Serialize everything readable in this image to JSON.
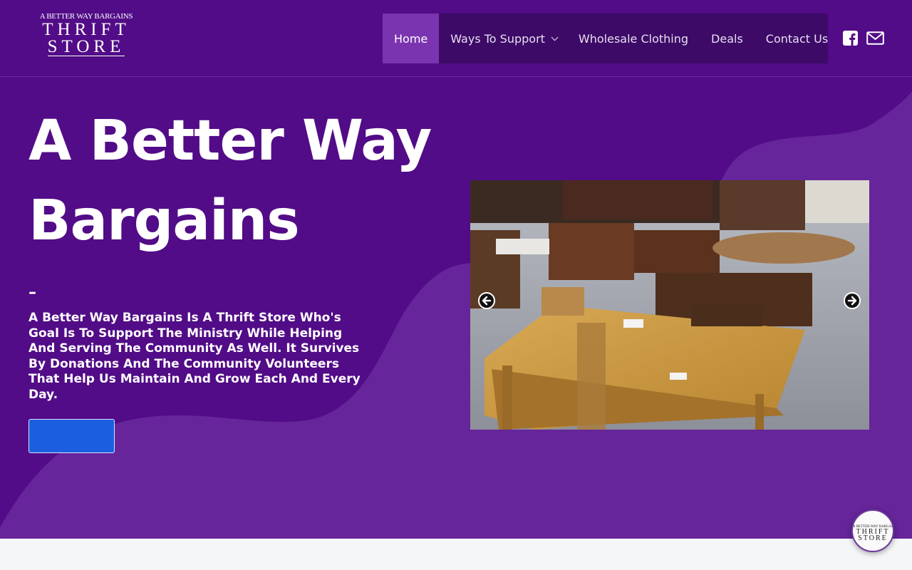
{
  "brand": {
    "logo_line1": "A BETTER WAY BARGAINS",
    "logo_line2": "THRIFT",
    "logo_line3": "STORE"
  },
  "nav": {
    "items": [
      {
        "label": "Home",
        "active": true
      },
      {
        "label": "Ways To Support",
        "has_dropdown": true
      },
      {
        "label": "Wholesale Clothing"
      },
      {
        "label": "Deals"
      },
      {
        "label": "Contact Us"
      }
    ]
  },
  "social": {
    "icons": [
      "facebook-icon",
      "mail-icon"
    ]
  },
  "hero": {
    "title": "A Better Way Bargains",
    "dash": "–",
    "description": "A Better Way Bargains Is A Thrift Store Who's Goal Is To Support The Ministry While Helping And Serving The Community As Well. It Survives By Donations And The Community Volunteers That Help Us Maintain And Grow Each And Every Day.",
    "cta_label": ""
  },
  "slider": {
    "icons": [
      "arrow-left-icon",
      "arrow-right-icon"
    ]
  },
  "chat_badge": {
    "line1": "A BETTER WAY BARGAINS",
    "line2": "THRIFT",
    "line3": "STORE"
  },
  "colors": {
    "hero_bg": "#520c87",
    "nav_bg": "#3d0a67",
    "nav_active": "#7b34b0",
    "cta_bg": "#1b5fe0"
  }
}
